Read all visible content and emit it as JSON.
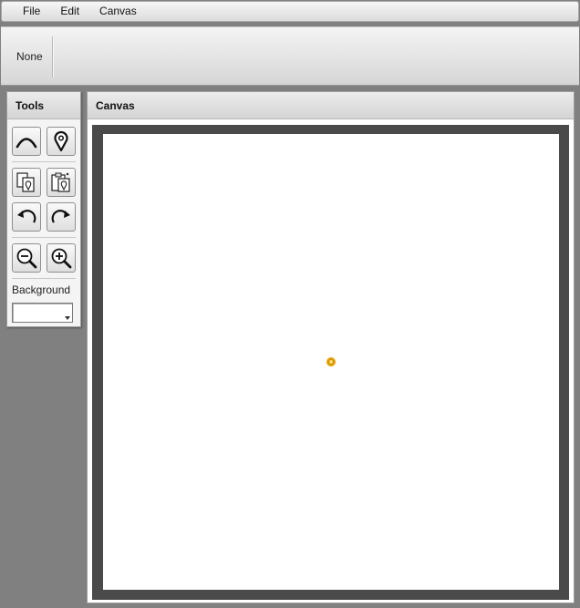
{
  "menu": {
    "items": [
      {
        "label": "File"
      },
      {
        "label": "Edit"
      },
      {
        "label": "Canvas"
      }
    ]
  },
  "propbar": {
    "selection_label": "None"
  },
  "tools": {
    "title": "Tools",
    "buttons": [
      {
        "name": "curve-tool",
        "icon": "arc-icon"
      },
      {
        "name": "point-tool",
        "icon": "map-pin-icon"
      },
      {
        "name": "copy",
        "icon": "copy-icon"
      },
      {
        "name": "paste",
        "icon": "paste-icon"
      },
      {
        "name": "undo",
        "icon": "undo-icon"
      },
      {
        "name": "redo",
        "icon": "redo-icon"
      },
      {
        "name": "zoom-out",
        "icon": "zoom-out-icon"
      },
      {
        "name": "zoom-in",
        "icon": "zoom-in-icon"
      }
    ],
    "background_label": "Background",
    "background_value": ""
  },
  "canvas": {
    "title": "Canvas",
    "frame_color": "#4a4a4a",
    "surface_color": "#ffffff",
    "point_fill": "#ffe070",
    "point_stroke": "#e8a000"
  }
}
